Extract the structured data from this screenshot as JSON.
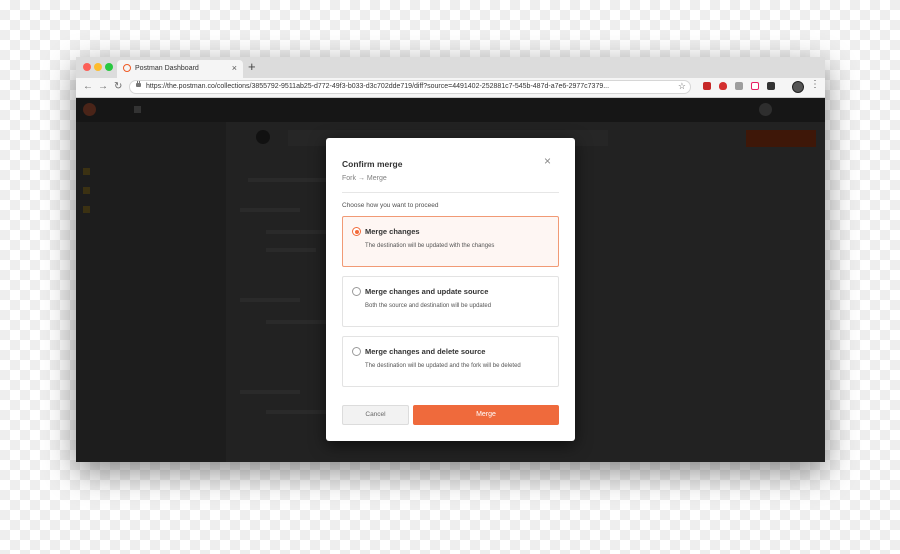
{
  "browser": {
    "tab_title": "Postman Dashboard",
    "tab_close": "×",
    "new_tab": "+",
    "url": "https://the.postman.co/collections/3855792-9511ab25-d772-49f3-b033-d3c702dde719/diff?source=4491402-252881c7-545b-487d-a7e6-2977c7379...",
    "nav": {
      "back": "←",
      "forward": "→",
      "reload": "↻",
      "bookmark": "☆",
      "menu": "⋮"
    }
  },
  "modal": {
    "title": "Confirm merge",
    "subtitle": "Fork → Merge",
    "close": "×",
    "prompt": "Choose how you want to proceed",
    "options": [
      {
        "label": "Merge changes",
        "description": "The destination will be updated with the changes",
        "selected": true
      },
      {
        "label": "Merge changes and update source",
        "description": "Both the source and destination will be updated",
        "selected": false
      },
      {
        "label": "Merge changes and delete source",
        "description": "The destination will be updated and the fork will be deleted",
        "selected": false
      }
    ],
    "cancel_label": "Cancel",
    "merge_label": "Merge"
  },
  "colors": {
    "accent": "#ef6a3c",
    "selected_border": "#f19a75",
    "selected_bg": "#fef6f3"
  }
}
